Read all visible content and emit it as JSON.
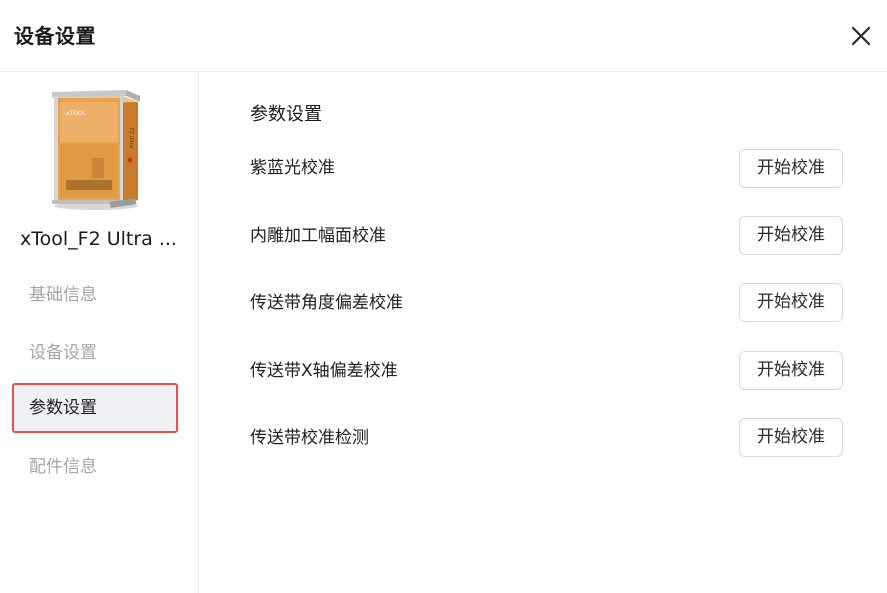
{
  "dialog": {
    "title": "设备设置",
    "close_icon": "close-icon"
  },
  "sidebar": {
    "device_name": "xTool_F2 Ultra ...",
    "device_logo_text": "xTOOL",
    "device_side_text": "F2 Ultra",
    "items": [
      {
        "label": "基础信息",
        "active": false
      },
      {
        "label": "设备设置",
        "active": false
      },
      {
        "label": "参数设置",
        "active": true
      },
      {
        "label": "配件信息",
        "active": false
      }
    ]
  },
  "main": {
    "section_title": "参数设置",
    "rows": [
      {
        "label": "紫蓝光校准",
        "button": "开始校准"
      },
      {
        "label": "内雕加工幅面校准",
        "button": "开始校准"
      },
      {
        "label": "传送带角度偏差校准",
        "button": "开始校准"
      },
      {
        "label": "传送带X轴偏差校准",
        "button": "开始校准"
      },
      {
        "label": "传送带校准检测",
        "button": "开始校准"
      }
    ]
  },
  "colors": {
    "active_border": "#e2534c",
    "active_bg": "#eef0f4",
    "inactive_text": "#a6a6a6",
    "device_orange": "#e59a3a"
  }
}
